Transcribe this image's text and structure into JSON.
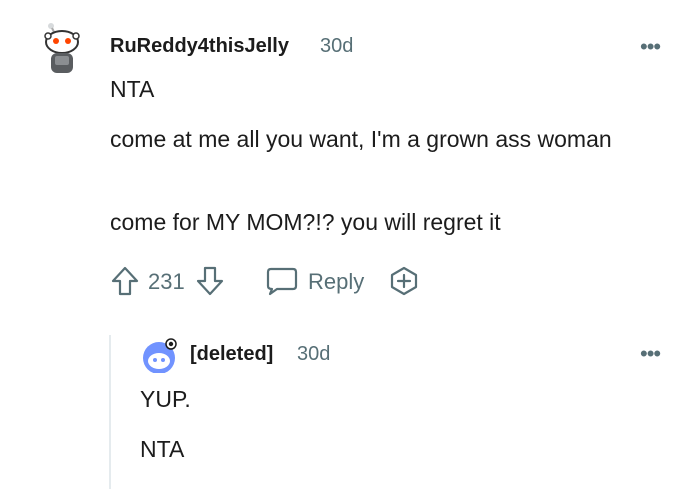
{
  "comment": {
    "username": "RuReddy4thisJelly",
    "time": "30d",
    "more": "•••",
    "paragraphs": [
      "NTA",
      "come at me all you want, I'm a grown ass woman",
      "come for MY MOM?!? you will regret it"
    ],
    "score": "231",
    "reply_label": "Reply",
    "icons": {
      "avatar": "snoo-avatar",
      "upvote": "upvote-arrow-icon",
      "downvote": "downvote-arrow-icon",
      "reply": "chat-bubble-icon",
      "award": "award-plus-icon",
      "more": "ellipsis-icon"
    }
  },
  "reply": {
    "username": "[deleted]",
    "time": "30d",
    "more": "•••",
    "paragraphs": [
      "YUP.",
      "NTA"
    ],
    "icons": {
      "avatar": "deleted-snoo-avatar",
      "more": "ellipsis-icon"
    }
  },
  "colors": {
    "text": "#1c1c1c",
    "meta": "#576f76",
    "thread_line": "#e5ebee",
    "avatar_blue": "#7193ff"
  }
}
